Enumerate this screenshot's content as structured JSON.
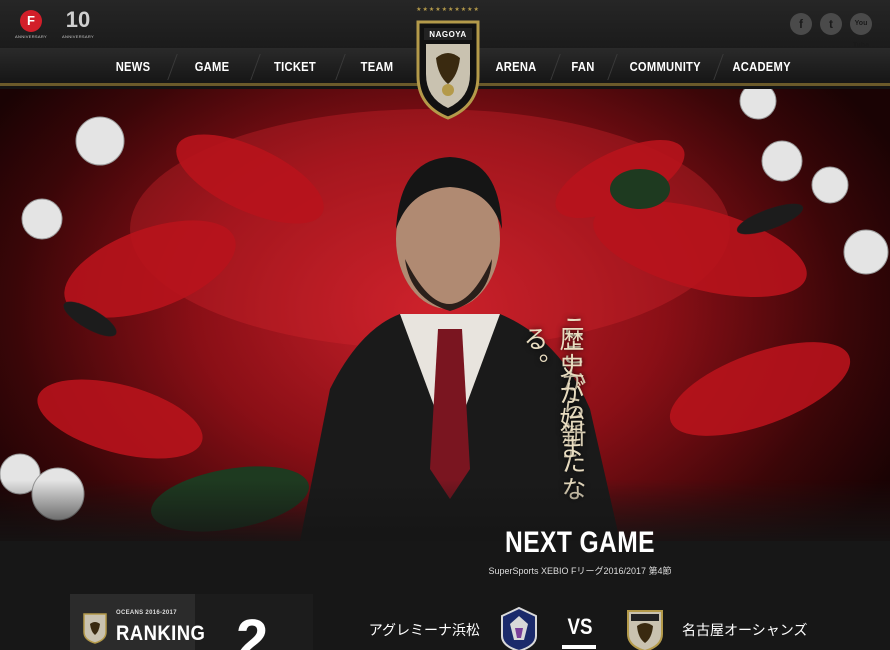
{
  "header": {
    "fleague_logo": {
      "mark": "F",
      "caption": "ANNIVERSARY"
    },
    "anniversary_logo": {
      "number": "10",
      "caption": "ANNIVERSARY"
    },
    "emblem_text": "NAGOYA",
    "social": {
      "facebook": "f",
      "twitter": "t",
      "youtube": "You Tube"
    }
  },
  "nav": {
    "items": [
      {
        "label": "NEWS"
      },
      {
        "label": "GAME"
      },
      {
        "label": "TICKET"
      },
      {
        "label": "TEAM"
      },
      {
        "label": "ARENA"
      },
      {
        "label": "FAN"
      },
      {
        "label": "COMMUNITY"
      },
      {
        "label": "ACADEMY"
      }
    ]
  },
  "hero": {
    "catch_line1": "ここから新たな",
    "catch_line2": "歴史が始まる。"
  },
  "next_game": {
    "title": "NEXT GAME",
    "subtitle": "SuperSports XEBIO Fリーグ2016/2017 第4節",
    "home_team": "アグレミーナ浜松",
    "vs": "VS",
    "away_team": "名古屋オーシャンズ"
  },
  "ranking": {
    "season": "OCEANS 2016-2017",
    "label": "RANKING",
    "value": "2"
  },
  "colors": {
    "accent_red": "#c8202a",
    "gold": "#b49a4a",
    "background": "#171717"
  }
}
